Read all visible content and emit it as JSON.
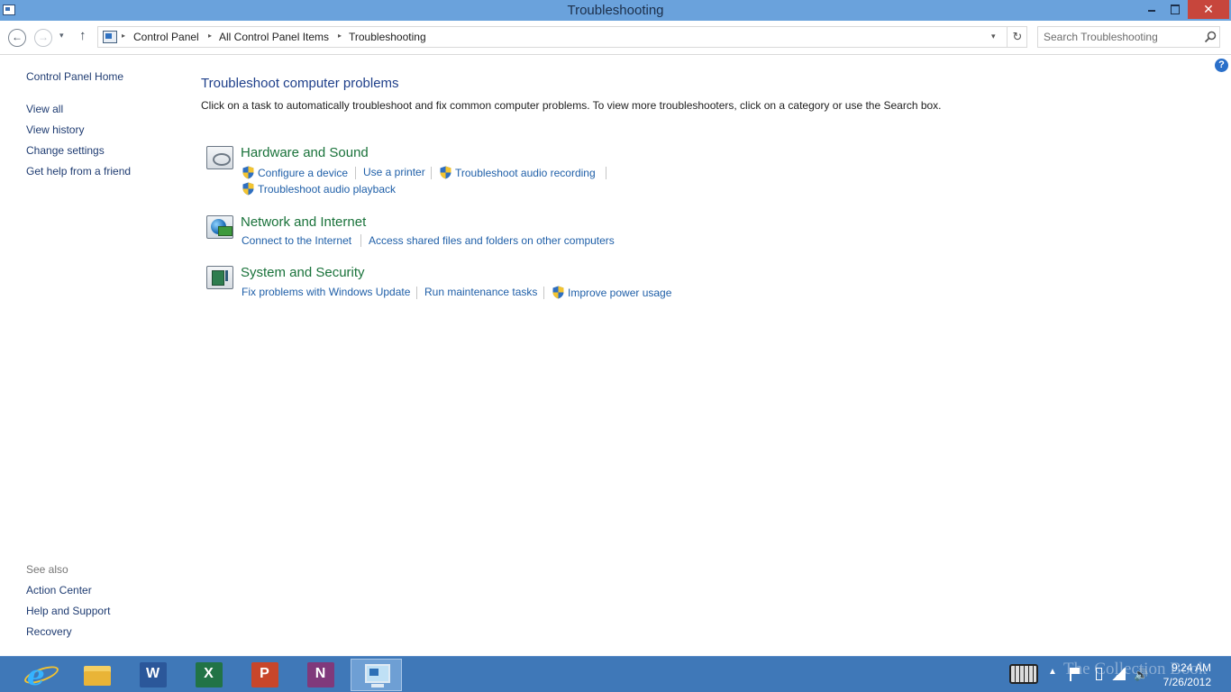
{
  "window": {
    "title": "Troubleshooting",
    "close_glyph": "✕"
  },
  "nav": {
    "back_glyph": "←",
    "forward_glyph": "→",
    "recent_glyph": "▾",
    "up_glyph": "↑",
    "breadcrumb": [
      "Control Panel",
      "All Control Panel Items",
      "Troubleshooting"
    ],
    "breadcrumb_sep": "▸",
    "dropdown_glyph": "▾",
    "refresh_glyph": "↻"
  },
  "search": {
    "placeholder": "Search Troubleshooting"
  },
  "help": {
    "label": "?"
  },
  "sidebar": {
    "home": "Control Panel Home",
    "items": [
      {
        "label": "View all"
      },
      {
        "label": "View history"
      },
      {
        "label": "Change settings"
      },
      {
        "label": "Get help from a friend"
      }
    ],
    "see_also_label": "See also",
    "see_also": [
      {
        "label": "Action Center"
      },
      {
        "label": "Help and Support"
      },
      {
        "label": "Recovery"
      }
    ]
  },
  "main": {
    "title": "Troubleshoot computer problems",
    "description": "Click on a task to automatically troubleshoot and fix common computer problems. To view more troubleshooters, click on a category or use the Search box.",
    "categories": [
      {
        "title": "Hardware and Sound",
        "icon": "hardware-sound-icon",
        "links": [
          {
            "label": "Configure a device",
            "shield": true
          },
          {
            "label": "Use a printer",
            "shield": false
          },
          {
            "label": "Troubleshoot audio recording",
            "shield": true
          },
          {
            "label": "Troubleshoot audio playback",
            "shield": true
          }
        ]
      },
      {
        "title": "Network and Internet",
        "icon": "network-globe-icon",
        "links": [
          {
            "label": "Connect to the Internet",
            "shield": false
          },
          {
            "label": "Access shared files and folders on other computers",
            "shield": false
          }
        ]
      },
      {
        "title": "System and Security",
        "icon": "system-security-icon",
        "links": [
          {
            "label": "Fix problems with Windows Update",
            "shield": false
          },
          {
            "label": "Run maintenance tasks",
            "shield": false
          },
          {
            "label": "Improve power usage",
            "shield": true
          }
        ]
      }
    ]
  },
  "taskbar": {
    "apps": [
      {
        "name": "Internet Explorer",
        "glyph": "e"
      },
      {
        "name": "File Explorer"
      },
      {
        "name": "Word",
        "letter": "W",
        "color": "#2b579a"
      },
      {
        "name": "Excel",
        "letter": "X",
        "color": "#217346"
      },
      {
        "name": "PowerPoint",
        "letter": "P",
        "color": "#c8462b"
      },
      {
        "name": "OneNote",
        "letter": "N",
        "color": "#80397b"
      },
      {
        "name": "Control Panel",
        "active": true
      }
    ],
    "watermark": "The Collection Book",
    "tray_up_glyph": "▲",
    "volume_glyph": "🔊",
    "time": "9:24 AM",
    "date": "7/26/2012"
  },
  "colors": {
    "titlebar": "#6aa2dc",
    "taskbar": "#3f78b8",
    "link": "#1f5fa8",
    "category_title": "#19723a",
    "page_title": "#1e3f8a",
    "close_button": "#c7463c"
  }
}
